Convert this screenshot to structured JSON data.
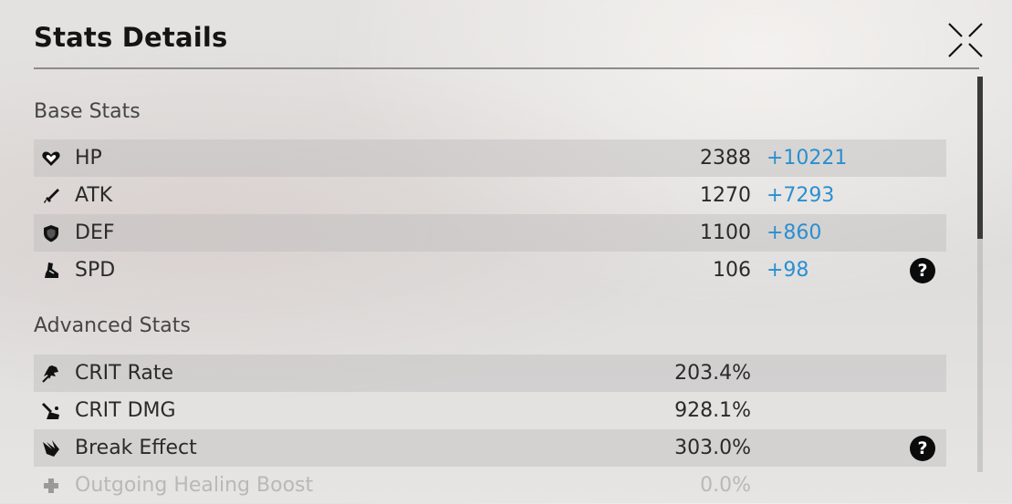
{
  "header": {
    "title": "Stats Details",
    "close_icon": "close-x-icon"
  },
  "base_stats": {
    "label": "Base Stats",
    "rows": [
      {
        "name": "HP",
        "icon": "heart-icon",
        "base": "2388",
        "bonus": "+10221"
      },
      {
        "name": "ATK",
        "icon": "sword-icon",
        "base": "1270",
        "bonus": "+7293"
      },
      {
        "name": "DEF",
        "icon": "shield-icon",
        "base": "1100",
        "bonus": "+860"
      },
      {
        "name": "SPD",
        "icon": "boot-icon",
        "base": "106",
        "bonus": "+98",
        "help": "?"
      }
    ]
  },
  "advanced_stats": {
    "label": "Advanced Stats",
    "rows": [
      {
        "name": "CRIT Rate",
        "icon": "crit-rate-icon",
        "value": "203.4%"
      },
      {
        "name": "CRIT DMG",
        "icon": "crit-dmg-icon",
        "value": "928.1%"
      },
      {
        "name": "Break Effect",
        "icon": "break-effect-icon",
        "value": "303.0%",
        "help": "?"
      },
      {
        "name": "Outgoing Healing Boost",
        "icon": "healing-icon",
        "value": "0.0%"
      }
    ]
  },
  "colors": {
    "bonus": "#2a8fd0",
    "row_shade": "#cfcecd",
    "title": "#141414"
  }
}
